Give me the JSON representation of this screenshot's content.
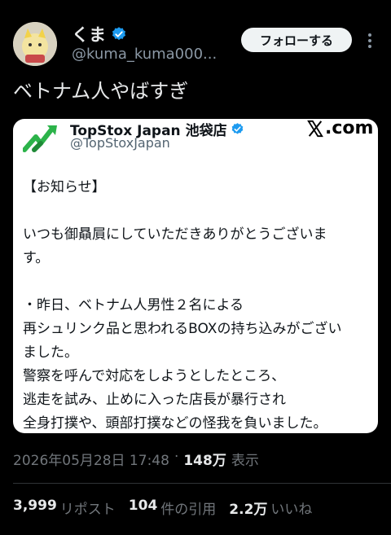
{
  "user": {
    "display_name": "くま",
    "handle": "@kuma_kuma000...",
    "verified_color": "#1d9bf0"
  },
  "actions": {
    "follow_label": "フォローする",
    "more_icon": "more-vertical-icon"
  },
  "tweet": {
    "text": "ベトナム人やばすぎ"
  },
  "quoted_card": {
    "name": "TopStox Japan 池袋店",
    "handle": "@TopStoxJapan",
    "source": ".com",
    "brand_color": "#2cb34a",
    "body": [
      "【お知らせ】",
      "",
      "いつも御贔屓にしていただきありがとうございま",
      "す。",
      "",
      "・昨日、ベトナム人男性２名による",
      "再シュリンク品と思われるBOXの持ち込みがござい",
      "ました。",
      "警察を呼んで対応をしようとしたところ、",
      "逃走を試み、止めに入った店長が暴行され",
      "全身打撲や、頭部打撲などの怪我を負いました。"
    ]
  },
  "meta": {
    "timestamp": "2026年05月28日 17:48",
    "separator": "·",
    "views": "148万",
    "views_label": "表示"
  },
  "stats": {
    "reposts": "3,999",
    "reposts_label": "リポスト",
    "quotes": "104",
    "quotes_label": "件の引用",
    "likes": "2.2万",
    "likes_label": "いいね"
  }
}
